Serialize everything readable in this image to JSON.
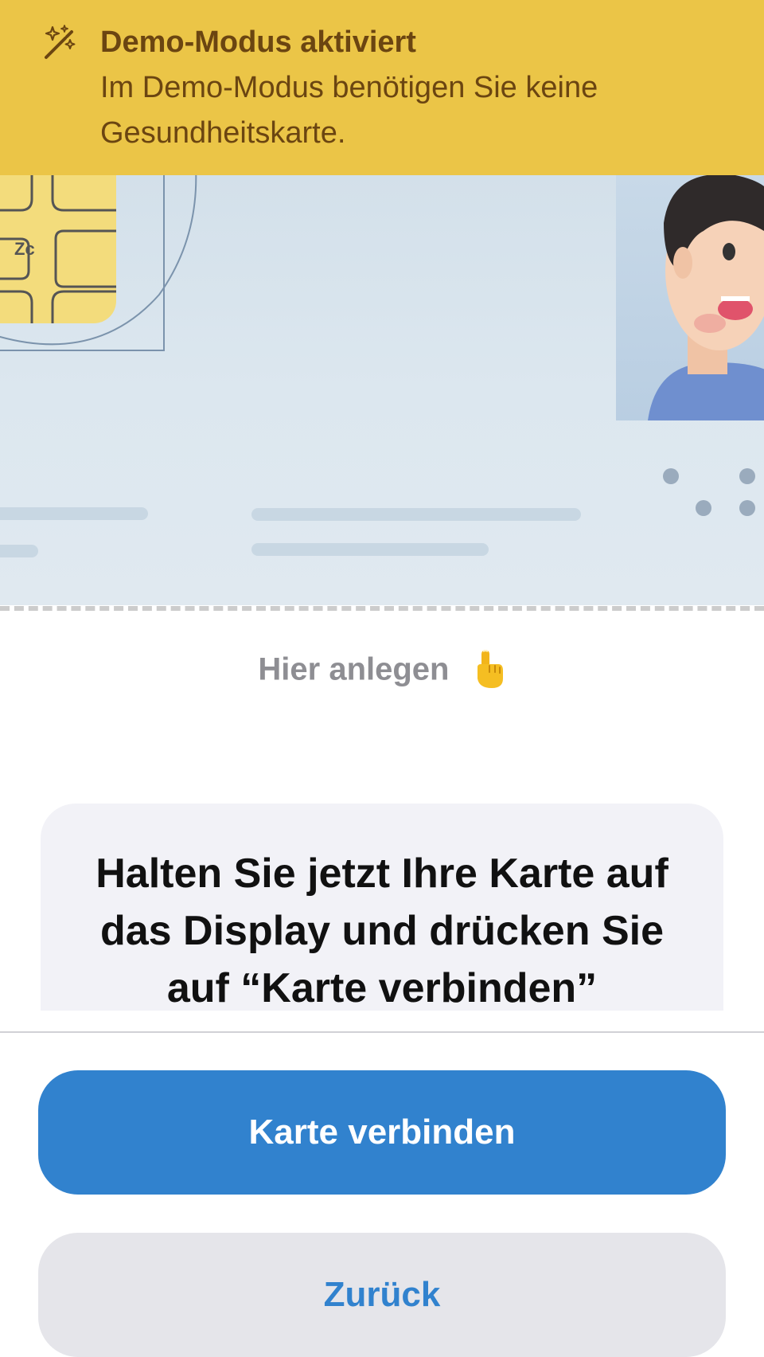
{
  "demo_banner": {
    "icon": "magic-wand-sparkles-icon",
    "title": "Demo-Modus aktiviert",
    "description": "Im Demo-Modus benötigen Sie keine Gesundheitskarte."
  },
  "card_illustration": {
    "chip_icon": "card-chip-icon",
    "photo_icon": "person-avatar-icon"
  },
  "hint": {
    "label": "Hier anlegen",
    "icon": "pointing-finger-icon"
  },
  "instruction": {
    "text": "Halten Sie jetzt Ihre Karte auf das Display und drücken Sie auf “Karte verbinden”"
  },
  "buttons": {
    "connect_label": "Karte verbinden",
    "back_label": "Zurück"
  },
  "colors": {
    "banner": "#ebc547",
    "banner_text": "#6b4511",
    "primary": "#3182ce",
    "secondary_bg": "#e5e5ea",
    "instruction_bg": "#f2f2f7"
  }
}
